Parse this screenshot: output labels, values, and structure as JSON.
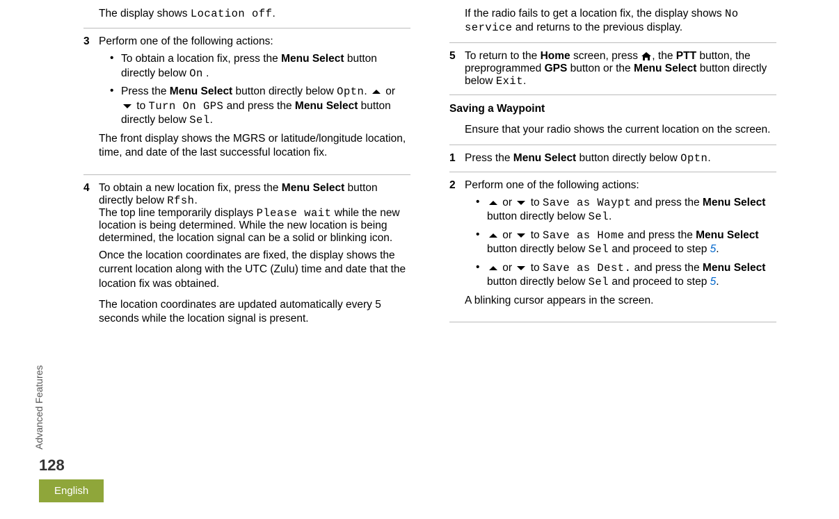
{
  "meta": {
    "side_tab": "Advanced Features",
    "page_number": "128",
    "language": "English"
  },
  "left": {
    "loc_off_before": "The display shows ",
    "loc_off_code": "Location off",
    "loc_off_after": ".",
    "step3_num": "3",
    "step3_intro": "Perform one of the following actions:",
    "step3_b1_a": "To obtain a location fix, press the ",
    "step3_b1_bold": "Menu Select",
    "step3_b1_b": " button directly below ",
    "step3_b1_code": "On",
    "step3_b1_c": " .",
    "step3_b2_a": "Press the ",
    "step3_b2_bold1": "Menu Select",
    "step3_b2_b": " button directly below ",
    "step3_b2_code1": "Optn",
    "step3_b2_c": ". ",
    "step3_b2_or": " or ",
    "step3_b2_to": " to ",
    "step3_b2_code2": "Turn On GPS",
    "step3_b2_d": " and press the ",
    "step3_b2_bold2": "Menu Select",
    "step3_b2_e": " button directly below ",
    "step3_b2_code3": "Sel",
    "step3_b2_f": ".",
    "step3_result": "The front display shows the MGRS or latitude/longitude location, time, and date of the last successful location fix.",
    "step4_num": "4",
    "step4_a": "To obtain a new location fix, press the ",
    "step4_bold": "Menu Select",
    "step4_b": " button directly below ",
    "step4_code1": "Rfsh",
    "step4_c": ".",
    "step4_line2_a": "The top line temporarily displays ",
    "step4_line2_code": "Please wait",
    "step4_line2_b": " while the new location is being determined. While the new location is being determined, the location signal can be a solid or blinking icon.",
    "step4_para2": "Once the location coordinates are fixed, the display shows the current location along with the UTC (Zulu) time and date that the location fix was obtained.",
    "step4_para3": "The location coordinates are updated automatically every 5 seconds while the location signal is present."
  },
  "right": {
    "fail_a": "If the radio fails to get a location fix, the display shows ",
    "fail_code": "No service",
    "fail_b": " and returns to the previous display.",
    "step5_num": "5",
    "step5_a": "To return to the ",
    "step5_bold1": "Home",
    "step5_b": " screen, press ",
    "step5_c": ", the ",
    "step5_bold2": "PTT",
    "step5_d": " button, the preprogrammed ",
    "step5_bold3": "GPS",
    "step5_e": " button or the ",
    "step5_bold4": "Menu Select",
    "step5_f": " button directly below ",
    "step5_code": "Exit",
    "step5_g": ".",
    "heading": "Saving a Waypoint",
    "ensure": "Ensure that your radio shows the current location on the screen.",
    "w1_num": "1",
    "w1_a": "Press the ",
    "w1_bold": "Menu Select",
    "w1_b": " button directly below ",
    "w1_code": "Optn",
    "w1_c": ".",
    "w2_num": "2",
    "w2_intro": "Perform one of the following actions:",
    "w2_or": " or ",
    "w2_to": " to ",
    "w2_b1_code": "Save as Waypt",
    "w2_b1_a": " and press the ",
    "w2_b1_bold": "Menu Select",
    "w2_b1_b": " button directly below ",
    "w2_b1_code2": "Sel",
    "w2_b1_c": ".",
    "w2_b2_code": "Save as Home",
    "w2_b2_a": " and press the ",
    "w2_b2_bold": "Menu Select",
    "w2_b2_b": " button directly below ",
    "w2_b2_code2": "Sel",
    "w2_b2_c": " and proceed to step ",
    "w2_b2_xref": "5",
    "w2_b2_d": ".",
    "w2_b3_code": "Save as Dest.",
    "w2_b3_a": " and press the ",
    "w2_b3_bold": "Menu Select",
    "w2_b3_b": " button directly below ",
    "w2_b3_code2": "Sel",
    "w2_b3_c": " and proceed to step ",
    "w2_b3_xref": "5",
    "w2_b3_d": ".",
    "w2_result": "A blinking cursor appears in the screen."
  }
}
